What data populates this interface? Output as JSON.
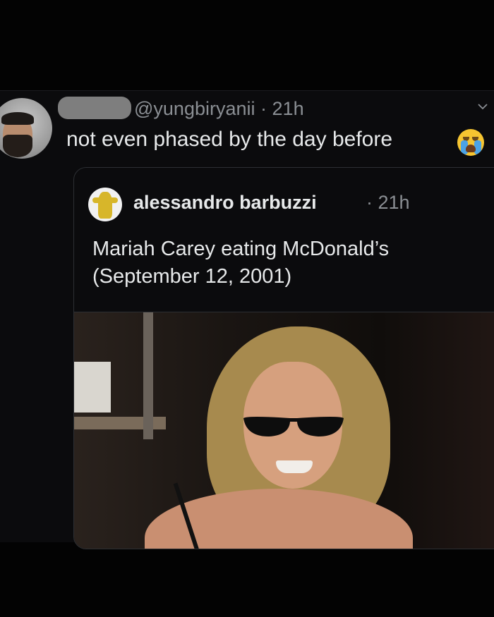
{
  "tweet": {
    "handle": "@yungbiryanii",
    "separator": "·",
    "time": "21h",
    "text": "not even phased by the day before",
    "emoji_name": "loudly-crying-face"
  },
  "quoted_tweet": {
    "display_name": "alessandro barbuzzi",
    "separator": "·",
    "time": "21h",
    "text_line1": "Mariah Carey eating McDonald’s",
    "text_line2": "(September 12, 2001)"
  },
  "colors": {
    "background": "#030303",
    "card": "#0b0b0d",
    "text": "#e7e9ea",
    "muted": "#8b8f94",
    "border": "#2c2f33"
  }
}
